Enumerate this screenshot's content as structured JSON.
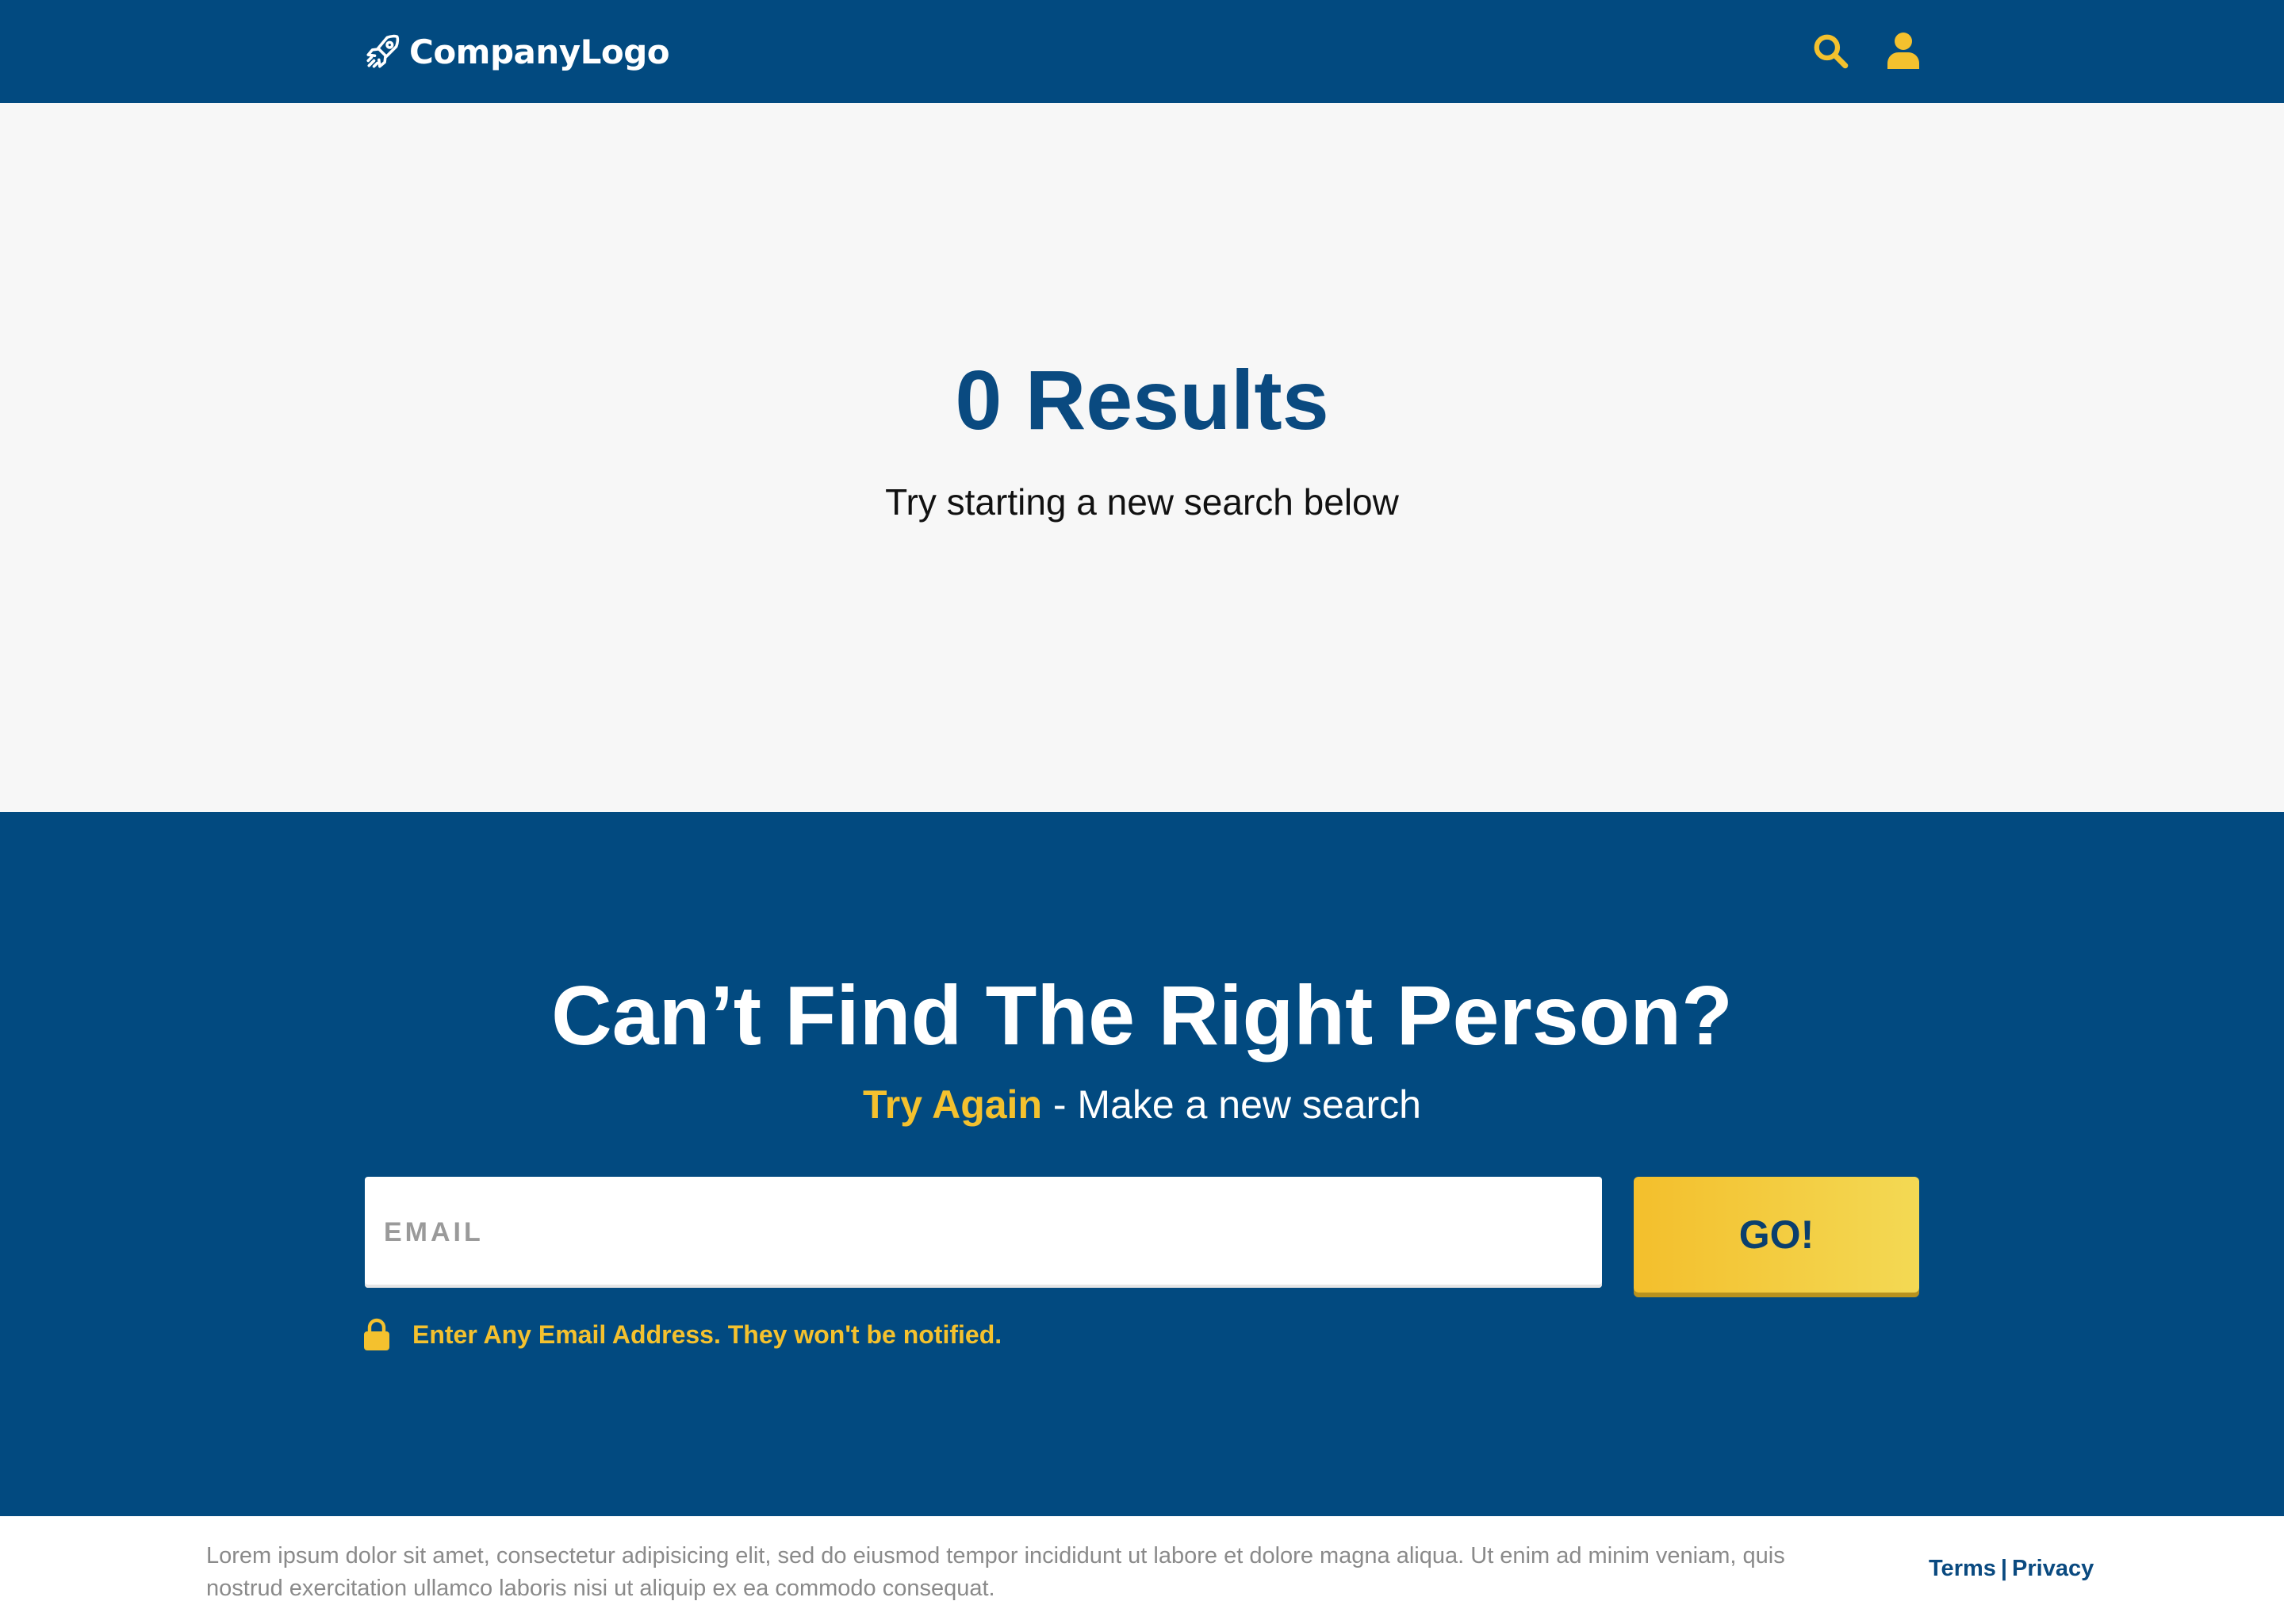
{
  "header": {
    "logo_text": "CompanyLogo",
    "logo_icon": "rocket-icon",
    "search_icon": "search-icon",
    "user_icon": "user-icon"
  },
  "hero": {
    "title": "0 Results",
    "subtitle": "Try starting a new search below"
  },
  "cta": {
    "title": "Can’t Find The Right Person?",
    "subtitle_highlight": "Try Again",
    "subtitle_rest": " - Make a new search",
    "email_placeholder": "EMAIL",
    "email_value": "",
    "go_label": "GO!",
    "notice_icon": "lock-icon",
    "notice_text": "Enter Any Email Address. They won't be notified."
  },
  "footer": {
    "text": "Lorem ipsum dolor sit amet, consectetur adipisicing elit, sed do eiusmod tempor incididunt ut labore et dolore magna aliqua. Ut enim ad minim veniam, quis nostrud exercitation ullamco laboris nisi ut aliquip ex ea commodo consequat.",
    "terms_label": "Terms",
    "separator": "|",
    "privacy_label": "Privacy"
  },
  "colors": {
    "primary_blue": "#024a80",
    "accent_yellow": "#f4c12e",
    "hero_bg": "#f7f7f7"
  }
}
